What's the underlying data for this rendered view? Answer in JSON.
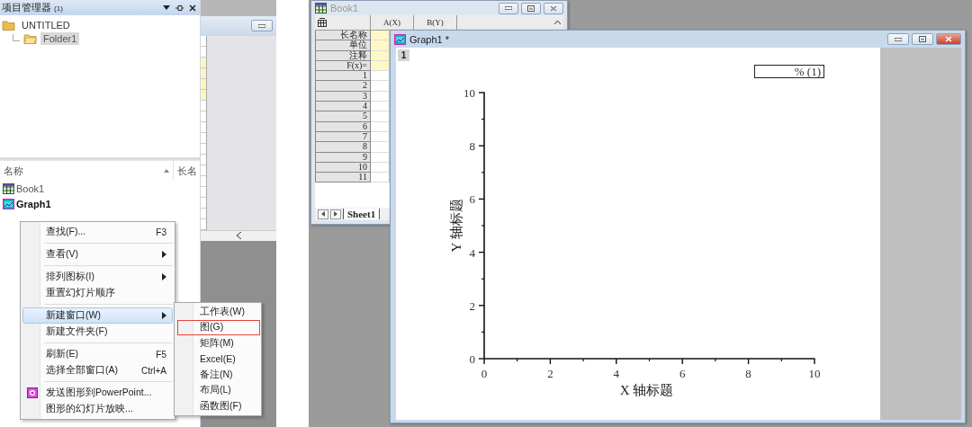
{
  "project_manager": {
    "title": "项目管理器",
    "count": "(1)",
    "tree": [
      {
        "label": "UNTITLED",
        "selected": false,
        "children": [
          {
            "label": "Folder1",
            "selected": true
          }
        ]
      }
    ],
    "list": {
      "columns": [
        "名称",
        "长名"
      ],
      "items": [
        {
          "name": "Book1",
          "kind": "workbook",
          "active": false
        },
        {
          "name": "Graph1",
          "kind": "graph",
          "active": true
        }
      ]
    }
  },
  "context_menu": {
    "items": [
      {
        "kind": "item",
        "label": "查找(F)...",
        "shortcut": "F3",
        "submenu": false,
        "selected": false
      },
      {
        "kind": "separator"
      },
      {
        "kind": "item",
        "label": "查看(V)",
        "submenu": true,
        "selected": false
      },
      {
        "kind": "separator"
      },
      {
        "kind": "item",
        "label": "排列图标(I)",
        "submenu": true,
        "selected": false
      },
      {
        "kind": "item",
        "label": "重置幻灯片顺序",
        "submenu": false,
        "selected": false
      },
      {
        "kind": "separator"
      },
      {
        "kind": "item",
        "label": "新建窗口(W)",
        "submenu": true,
        "selected": true
      },
      {
        "kind": "item",
        "label": "新建文件夹(F)",
        "submenu": false,
        "selected": false
      },
      {
        "kind": "separator"
      },
      {
        "kind": "item",
        "label": "刷新(E)",
        "shortcut": "F5",
        "submenu": false,
        "selected": false
      },
      {
        "kind": "item",
        "label": "选择全部窗口(A)",
        "shortcut": "Ctrl+A",
        "submenu": false,
        "selected": false
      },
      {
        "kind": "separator"
      },
      {
        "kind": "item",
        "label": "发送图形到PowerPoint...",
        "submenu": false,
        "selected": false,
        "has_icon": true
      },
      {
        "kind": "item",
        "label": "图形的幻灯片放映...",
        "submenu": false,
        "selected": false
      }
    ]
  },
  "submenu": {
    "items": [
      {
        "label": "工作表(W)",
        "outlined": false
      },
      {
        "label": "图(G)",
        "outlined": true
      },
      {
        "label": "矩阵(M)",
        "outlined": false
      },
      {
        "label": "Excel(E)",
        "outlined": false
      },
      {
        "label": "备注(N)",
        "outlined": false
      },
      {
        "label": "布局(L)",
        "outlined": false
      },
      {
        "label": "函数图(F)",
        "outlined": false
      }
    ]
  },
  "book_window": {
    "title": "Book1",
    "active": false,
    "columns": [
      "A(X)",
      "B(Y)"
    ],
    "rows": [
      {
        "label": "长名称",
        "kind": "header"
      },
      {
        "label": "单位",
        "kind": "header"
      },
      {
        "label": "注释",
        "kind": "header"
      },
      {
        "label": "F(x)=",
        "kind": "header"
      },
      {
        "label": "1",
        "kind": "data"
      },
      {
        "label": "2",
        "kind": "data"
      },
      {
        "label": "3",
        "kind": "data"
      },
      {
        "label": "4",
        "kind": "data"
      },
      {
        "label": "5",
        "kind": "data"
      },
      {
        "label": "6",
        "kind": "data"
      },
      {
        "label": "7",
        "kind": "data"
      },
      {
        "label": "8",
        "kind": "data"
      },
      {
        "label": "9",
        "kind": "data"
      },
      {
        "label": "10",
        "kind": "data"
      },
      {
        "label": "11",
        "kind": "data"
      }
    ],
    "sheet_tab": "Sheet1"
  },
  "graph_window": {
    "title": "Graph1 *",
    "active": true,
    "layer": "1",
    "legend": "% (1)",
    "chart_data": {
      "type": "line",
      "xlabel": "X 轴标题",
      "ylabel": "Y 轴标题",
      "xlim": [
        0,
        10
      ],
      "ylim": [
        0,
        10
      ],
      "xticks": [
        0,
        2,
        4,
        6,
        8,
        10
      ],
      "yticks": [
        0,
        2,
        4,
        6,
        8,
        10
      ]
    }
  }
}
